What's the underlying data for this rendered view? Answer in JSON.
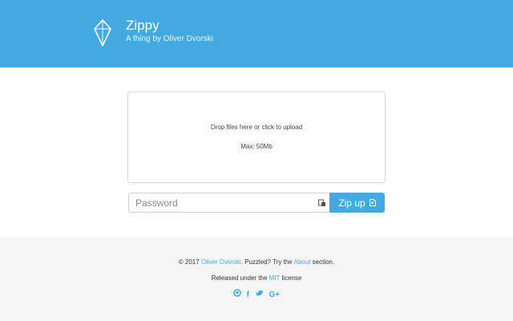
{
  "header": {
    "title": "Zippy",
    "subtitle": "A thing by Oliver Dvorski",
    "logo_icon": "crystal-logo-icon",
    "background_color": "#42a9e1"
  },
  "dropzone": {
    "main_text": "Drop files here or click to upload",
    "max_text": "Max: 50Mb"
  },
  "password": {
    "placeholder": "Password",
    "value": "",
    "icon": "key-icon"
  },
  "zip_button": {
    "label": "Zip up",
    "icon": "file-zip-icon"
  },
  "footer": {
    "copyright_prefix": "© 2017",
    "author_link": "Oliver Dvorski",
    "puzzled_text": ". Puzzled? Try the",
    "about_link": "About",
    "section_text": "section.",
    "released_prefix": "Released under the",
    "mit_link": "MIT",
    "license_text": "license",
    "social": {
      "github": "GitHub",
      "facebook": "Facebook",
      "twitter": "Twitter",
      "google": "G+"
    },
    "link_color": "#42a9e1"
  }
}
